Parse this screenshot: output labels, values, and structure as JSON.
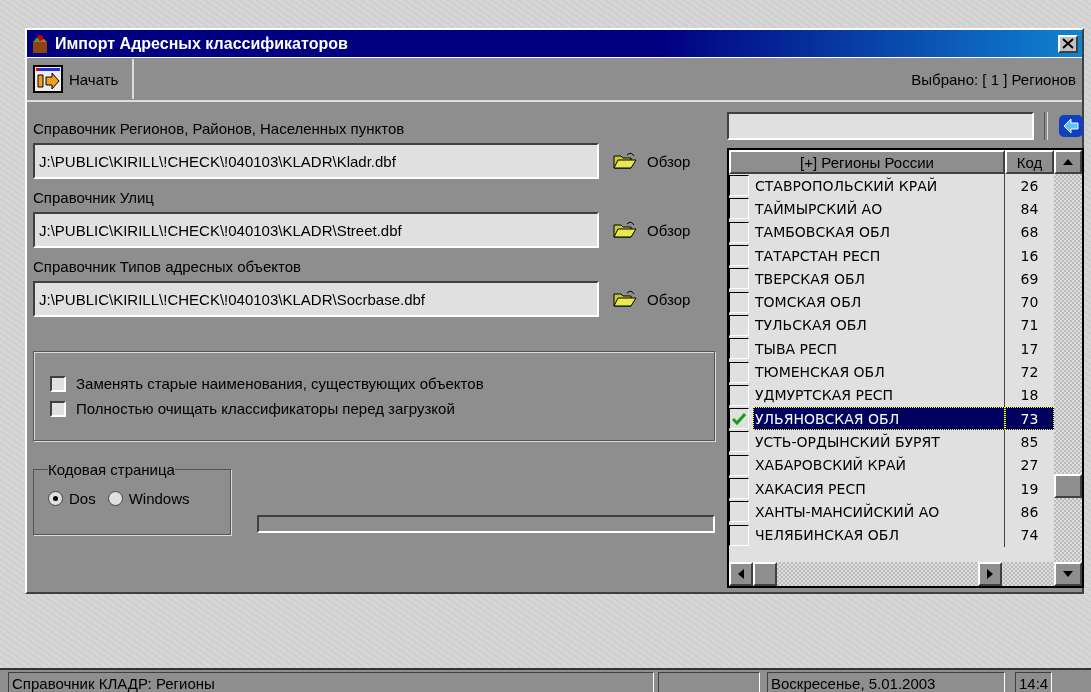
{
  "window": {
    "title": "Импорт Адресных классификаторов"
  },
  "toolbar": {
    "start_button": "Начать",
    "selected_info": "Выбрано: [  1 ] Регионов"
  },
  "files": [
    {
      "label": "Справочник Регионов, Районов, Населенных пунктов",
      "value": "J:\\PUBLIC\\KIRILL\\!CHECK\\!040103\\KLADR\\Kladr.dbf",
      "browse": "Обзор"
    },
    {
      "label": "Справочник Улиц",
      "value": "J:\\PUBLIC\\KIRILL\\!CHECK\\!040103\\KLADR\\Street.dbf",
      "browse": "Обзор"
    },
    {
      "label": "Справочник Типов адресных объектов",
      "value": "J:\\PUBLIC\\KIRILL\\!CHECK\\!040103\\KLADR\\Socrbase.dbf",
      "browse": "Обзор"
    }
  ],
  "options": [
    {
      "label": "Заменять старые наименования, существующих объектов",
      "checked": false
    },
    {
      "label": "Полностью очищать классификаторы перед загрузкой",
      "checked": false
    }
  ],
  "codepage": {
    "title": "Кодовая страница",
    "options": [
      {
        "label": "Dos",
        "selected": true
      },
      {
        "label": "Windows",
        "selected": false
      }
    ]
  },
  "progress": {
    "level": 0
  },
  "regions": {
    "columns": [
      "[+] Регионы России",
      "Код"
    ],
    "rows": [
      {
        "name": "СТАВРОПОЛЬСКИЙ КРАЙ",
        "code": "26",
        "checked": false,
        "selected": false
      },
      {
        "name": "ТАЙМЫРСКИЙ АО",
        "code": "84",
        "checked": false,
        "selected": false
      },
      {
        "name": "ТАМБОВСКАЯ ОБЛ",
        "code": "68",
        "checked": false,
        "selected": false
      },
      {
        "name": "ТАТАРСТАН РЕСП",
        "code": "16",
        "checked": false,
        "selected": false
      },
      {
        "name": "ТВЕРСКАЯ ОБЛ",
        "code": "69",
        "checked": false,
        "selected": false
      },
      {
        "name": "ТОМСКАЯ ОБЛ",
        "code": "70",
        "checked": false,
        "selected": false
      },
      {
        "name": "ТУЛЬСКАЯ ОБЛ",
        "code": "71",
        "checked": false,
        "selected": false
      },
      {
        "name": "ТЫВА РЕСП",
        "code": "17",
        "checked": false,
        "selected": false
      },
      {
        "name": "ТЮМЕНСКАЯ ОБЛ",
        "code": "72",
        "checked": false,
        "selected": false
      },
      {
        "name": "УДМУРТСКАЯ РЕСП",
        "code": "18",
        "checked": false,
        "selected": false
      },
      {
        "name": "УЛЬЯНОВСКАЯ ОБЛ",
        "code": "73",
        "checked": true,
        "selected": true
      },
      {
        "name": "УСТЬ-ОРДЫНСКИЙ БУРЯТ",
        "code": "85",
        "checked": false,
        "selected": false
      },
      {
        "name": "ХАБАРОВСКИЙ КРАЙ",
        "code": "27",
        "checked": false,
        "selected": false
      },
      {
        "name": "ХАКАСИЯ РЕСП",
        "code": "19",
        "checked": false,
        "selected": false
      },
      {
        "name": "ХАНТЫ-МАНСИЙСКИЙ АО",
        "code": "86",
        "checked": false,
        "selected": false
      },
      {
        "name": "ЧЕЛЯБИНСКАЯ ОБЛ",
        "code": "74",
        "checked": false,
        "selected": false
      }
    ]
  },
  "status_bar": {
    "message": "Справочник КЛАДР: Регионы",
    "date": "Воскресенье, 5.01.2003",
    "time": "14:4"
  }
}
